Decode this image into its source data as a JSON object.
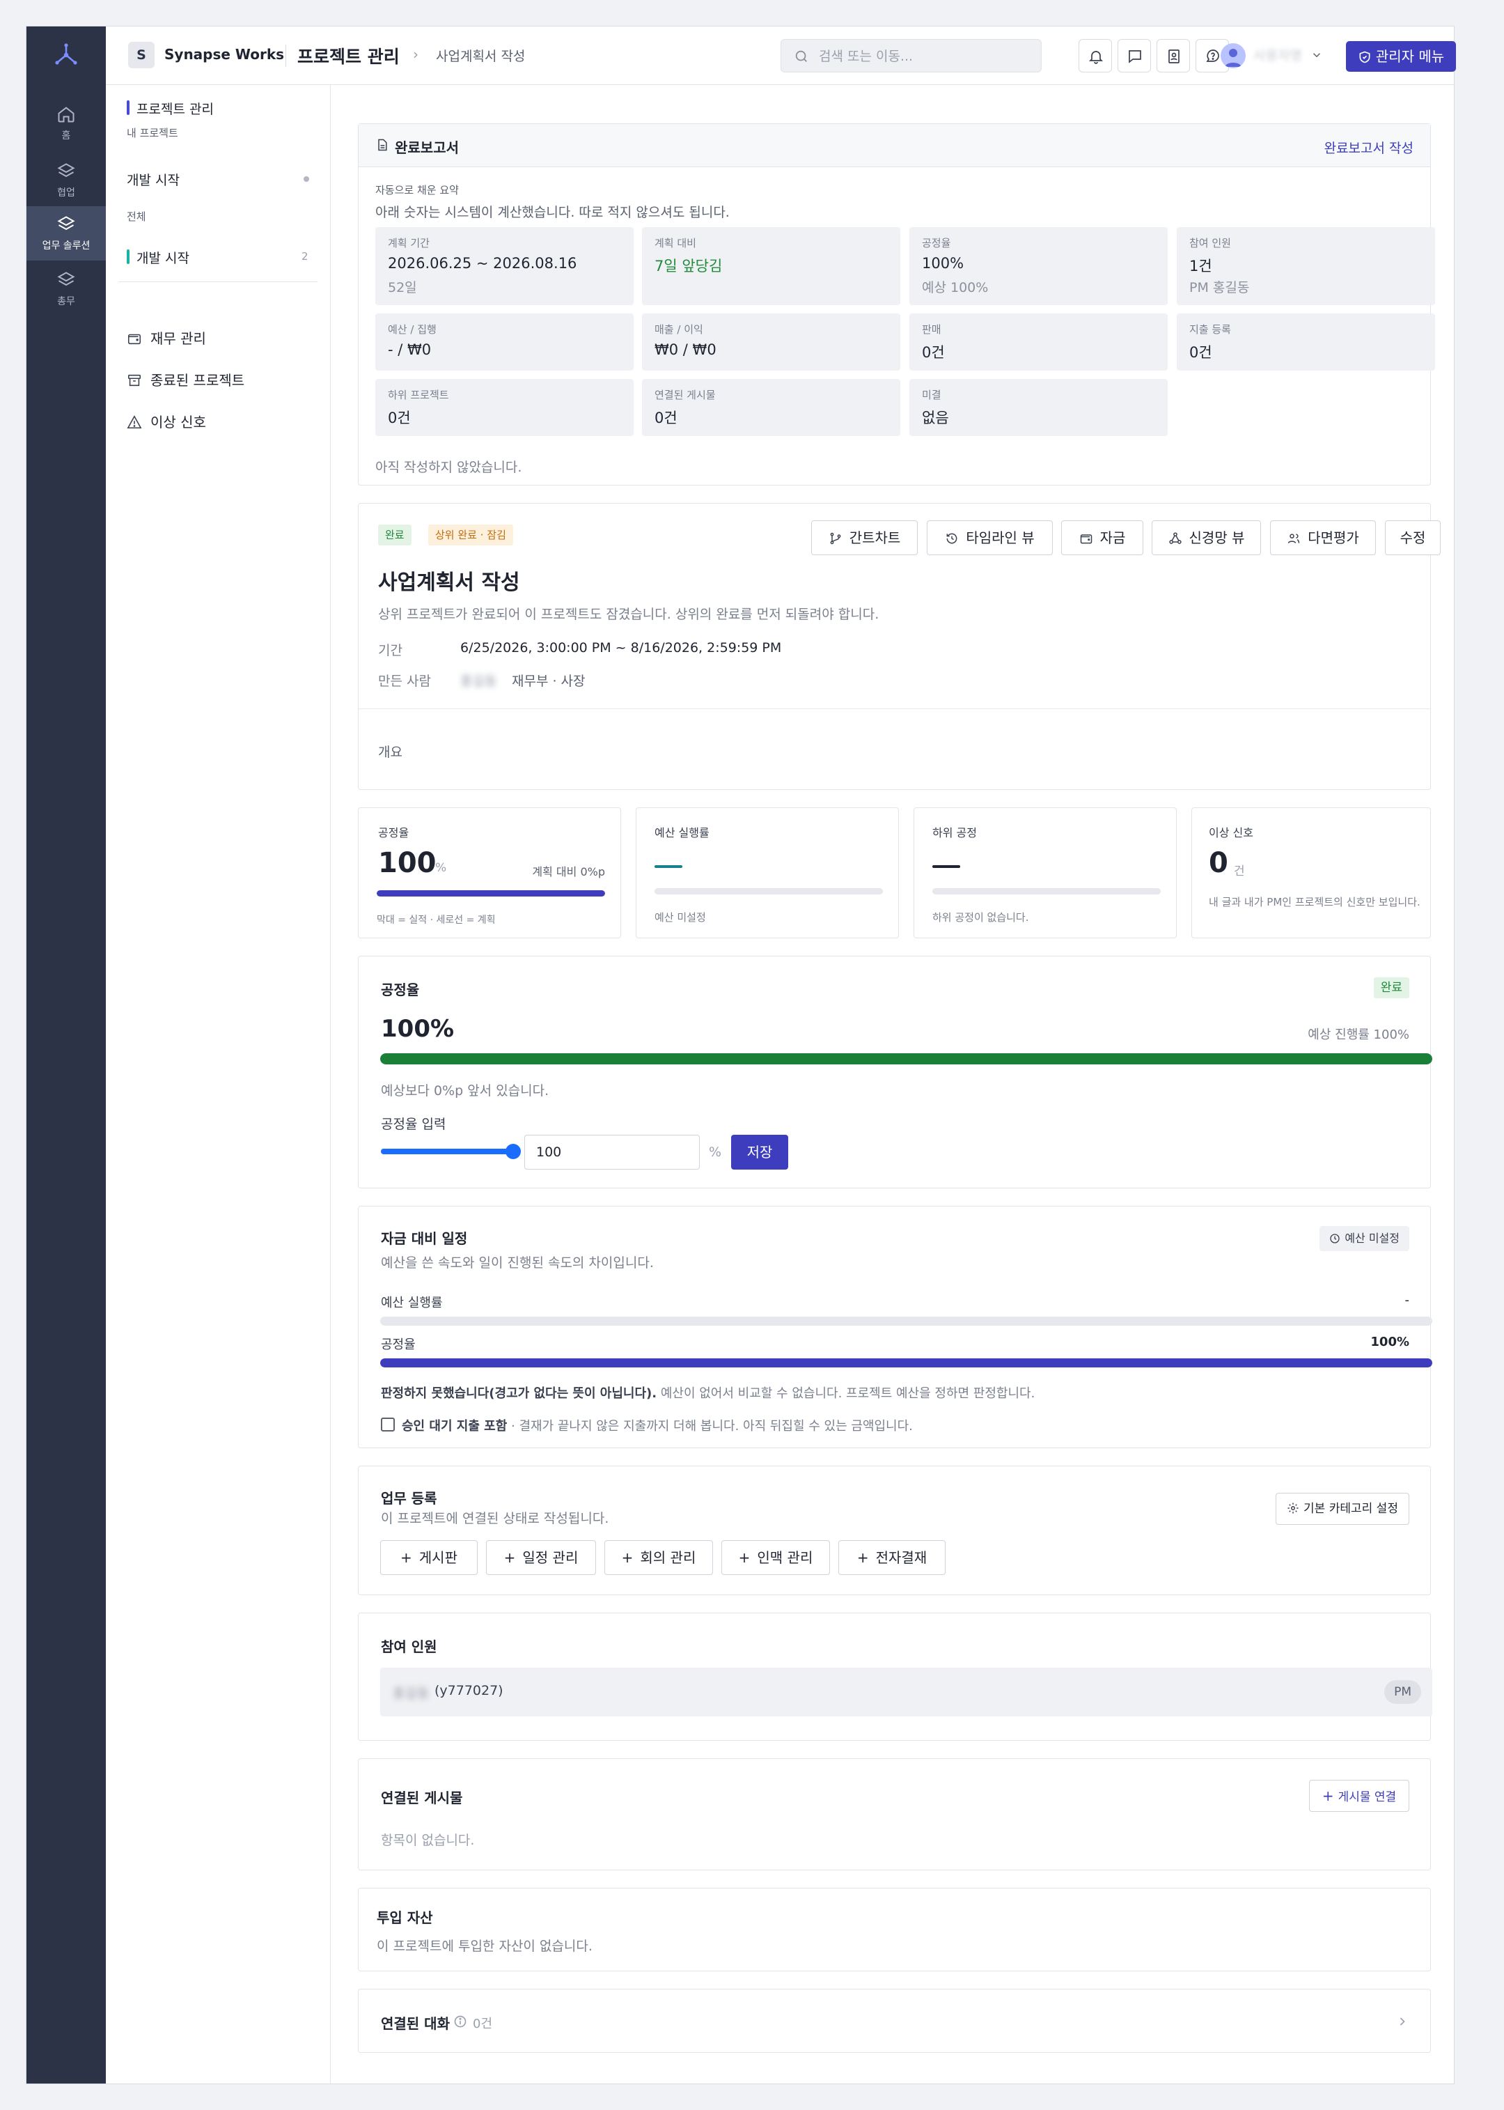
{
  "colors": {
    "rail": "#2c3346",
    "accent": "#3d3dbd",
    "success": "#1f8a3b",
    "teal": "#17b3a3",
    "warn": "#e08a1e"
  },
  "rail": {
    "items": [
      {
        "label": "홈",
        "icon": "home-icon"
      },
      {
        "label": "협업",
        "icon": "layers-icon"
      },
      {
        "label": "업무 솔루션",
        "icon": "layers-icon"
      },
      {
        "label": "총무",
        "icon": "layers-icon"
      }
    ]
  },
  "topbar": {
    "brand_initial": "S",
    "brand_name": "Synapse Works",
    "breadcrumb_main": "프로젝트 관리",
    "breadcrumb_sep": "›",
    "breadcrumb_sub": "사업계획서 작성",
    "search_placeholder": "검색 또는 이동...",
    "user_name": "사용자명",
    "admin_label": "관리자 메뉴"
  },
  "sidebar": {
    "section_title": "프로젝트 관리",
    "section_sub": "내 프로젝트",
    "group1": "개발 시작",
    "group1_sub": "전체",
    "group2": "개발 시작",
    "group2_count": "2",
    "items": [
      {
        "label": "재무 관리",
        "icon": "wallet-icon"
      },
      {
        "label": "종료된 프로젝트",
        "icon": "archive-icon"
      },
      {
        "label": "이상 신호",
        "icon": "warning-icon"
      }
    ]
  },
  "report": {
    "title": "완료보고서",
    "action": "완료보고서 작성",
    "auto_label": "자동으로 채운 요약",
    "auto_desc": "아래 숫자는 시스템이 계산했습니다. 따로 적지 않으셔도 됩니다.",
    "tiles": [
      {
        "label": "계획 기간",
        "value": "2026.06.25 ~ 2026.08.16",
        "sub": "52일"
      },
      {
        "label": "계획 대비",
        "value": "7일 앞당김",
        "sub": ""
      },
      {
        "label": "공정율",
        "value": "100%",
        "sub": "예상 100%"
      },
      {
        "label": "참여 인원",
        "value": "1건",
        "sub": "PM 홍길동"
      },
      {
        "label": "예산 / 집행",
        "value": "- / ₩0",
        "sub": ""
      },
      {
        "label": "매출 / 이익",
        "value": "₩0 / ₩0",
        "sub": ""
      },
      {
        "label": "판매",
        "value": "0건",
        "sub": ""
      },
      {
        "label": "지출 등록",
        "value": "0건",
        "sub": ""
      },
      {
        "label": "하위 프로젝트",
        "value": "0건",
        "sub": ""
      },
      {
        "label": "연결된 게시물",
        "value": "0건",
        "sub": ""
      },
      {
        "label": "미결",
        "value": "없음",
        "sub": ""
      }
    ],
    "footer": "아직 작성하지 않았습니다."
  },
  "project": {
    "badge_done": "완료",
    "badge_locked": "상위 완료 · 잠김",
    "title": "사업계획서 작성",
    "desc": "상위 프로젝트가 완료되어 이 프로젝트도 잠겼습니다. 상위의 완료를 먼저 되돌려야 합니다.",
    "period_label": "기간",
    "period_value": "6/25/2026, 3:00:00 PM ~ 8/16/2026, 2:59:59 PM",
    "creator_label": "만든 사람",
    "creator_name": "홍길동",
    "creator_dept": "재무부 · 사장",
    "overview_label": "개요",
    "buttons": [
      "간트차트",
      "타임라인 뷰",
      "자금",
      "신경망 뷰",
      "다면평가",
      "수정"
    ]
  },
  "kpis": {
    "progress": {
      "label": "공정율",
      "value": "100",
      "unit": "%",
      "compare": "계획 대비 0%p",
      "legend": "막대 = 실적 · 세로선 = 계획",
      "fill": 1.0
    },
    "budget": {
      "label": "예산 실행률",
      "value": "—",
      "note": "예산 미설정"
    },
    "sub": {
      "label": "하위 공정",
      "value": "—",
      "note": "하위 공정이 없습니다."
    },
    "signal": {
      "label": "이상 신호",
      "value": "0",
      "unit": "건",
      "note": "내 글과 내가 PM인 프로젝트의 신호만 보입니다."
    }
  },
  "progress_card": {
    "title": "공정율",
    "badge": "완료",
    "value": "100%",
    "expected": "예상 진행률 100%",
    "fill": 1.0,
    "note": "예상보다 0%p 앞서 있습니다.",
    "input_label": "공정율 입력",
    "input_value": "100",
    "slider_value": 100,
    "unit": "%",
    "save": "저장"
  },
  "fund_card": {
    "title": "자금 대비 일정",
    "badge": "예산 미설정",
    "desc": "예산을 쓴 속도와 일이 진행된 속도의 차이입니다.",
    "budget_label": "예산 실행률",
    "budget_value": "-",
    "budget_fill": 0,
    "progress_label": "공정율",
    "progress_value": "100%",
    "progress_fill": 1.0,
    "verdict_bold": "판정하지 못했습니다(경고가 없다는 뜻이 아닙니다).",
    "verdict_rest": " 예산이 없어서 비교할 수 없습니다. 프로젝트 예산을 정하면 판정합니다.",
    "check_label": "승인 대기 지출 포함",
    "check_desc": " · 결재가 끝나지 않은 지출까지 더해 봅니다. 아직 뒤집힐 수 있는 금액입니다."
  },
  "work_card": {
    "title": "업무 등록",
    "desc": "이 프로젝트에 연결된 상태로 작성됩니다.",
    "settings": "기본 카테고리 설정",
    "buttons": [
      "게시판",
      "일정 관리",
      "회의 관리",
      "인맥 관리",
      "전자결재"
    ]
  },
  "members_card": {
    "title": "참여 인원",
    "member_name": "홍길동",
    "member_id": "(y777027)",
    "role": "PM"
  },
  "posts_card": {
    "title": "연결된 게시물",
    "action": "게시물 연결",
    "empty": "항목이 없습니다."
  },
  "assets_card": {
    "title": "투입 자산",
    "empty": "이 프로젝트에 투입한 자산이 없습니다."
  },
  "chat_card": {
    "title": "연결된 대화",
    "count": "0건"
  }
}
